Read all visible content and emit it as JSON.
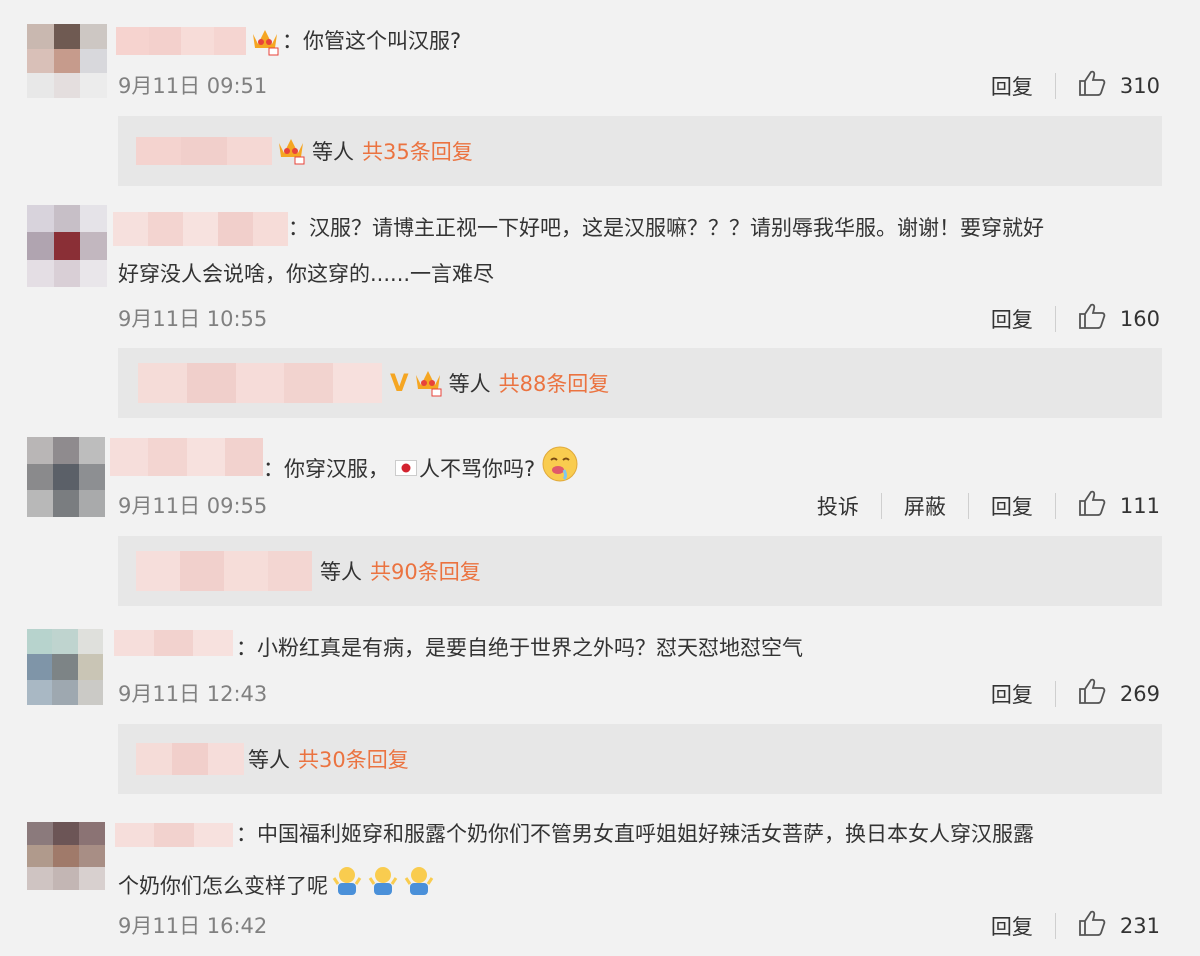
{
  "colors": {
    "accent": "#eb7340",
    "time": "#808080",
    "text": "#333333",
    "reply_bg": "#e7e7e7"
  },
  "comments": [
    {
      "text_lines": [
        "：你管这个叫汉服?"
      ],
      "time": "9月11日 09:51",
      "reply": "回复",
      "likes": "310",
      "thread": {
        "suffix": "等人",
        "count": "共35条回复"
      }
    },
    {
      "text_lines": [
        "：汉服？请博主正视一下好吧，这是汉服嘛？？？请别辱我华服。谢谢！要穿就好",
        "好穿没人会说啥，你这穿的......一言难尽"
      ],
      "time": "9月11日 10:55",
      "reply": "回复",
      "likes": "160",
      "thread": {
        "verified": "V",
        "suffix": "等人",
        "count": "共88条回复"
      }
    },
    {
      "text_prefix": "：你穿汉服，",
      "text_suffix": "人不骂你吗?",
      "time": "9月11日 09:55",
      "report": "投诉",
      "block": "屏蔽",
      "reply": "回复",
      "likes": "111",
      "thread": {
        "suffix": "等人",
        "count": "共90条回复"
      }
    },
    {
      "text_lines": [
        "：小粉红真是有病，是要自绝于世界之外吗？怼天怼地怼空气"
      ],
      "time": "9月11日 12:43",
      "reply": "回复",
      "likes": "269",
      "thread": {
        "suffix": "等人",
        "count": "共30条回复"
      }
    },
    {
      "text_lines": [
        "：中国福利姬穿和服露个奶你们不管男女直呼姐姐好辣活女菩萨，换日本女人穿汉服露",
        "个奶你们怎么变样了呢"
      ],
      "time": "9月11日 16:42",
      "reply": "回复",
      "likes": "231"
    }
  ],
  "icons": {
    "like": "thumbs-up-icon",
    "crown": "crown-badge-icon",
    "flag": "japan-flag-icon",
    "emoji_face": "drooling-face-emoji",
    "emoji_shrug": "shrug-person-emoji"
  }
}
